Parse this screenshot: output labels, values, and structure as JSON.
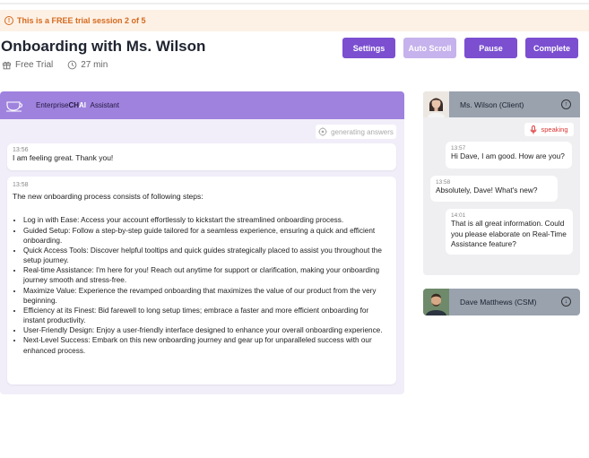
{
  "banner": {
    "text": "This is a FREE trial session 2 of 5"
  },
  "session": {
    "title": "Onboarding with Ms. Wilson",
    "type": "Free Trial",
    "duration": "27 min"
  },
  "toolbar": {
    "settings_label": "Settings",
    "auto_scroll_label": "Auto Scroll",
    "pause_label": "Pause",
    "complete_label": "Complete"
  },
  "assistant": {
    "brand_prefix": "Enterprise",
    "brand_ch": "CH",
    "brand_ai": "AI",
    "brand_suffix": "Assistant",
    "status": "generating answers",
    "messages": [
      {
        "time": "13:56",
        "text": "I am feeling great. Thank you!"
      },
      {
        "time": "13:58",
        "intro": "The new onboarding process consists of following steps:",
        "steps": [
          "Log in with Ease: Access your account effortlessly to kickstart the streamlined onboarding process.",
          "Guided Setup: Follow a step-by-step guide tailored for a seamless experience, ensuring a quick and efficient onboarding.",
          "Quick Access Tools: Discover helpful tooltips and quick guides strategically placed to assist you throughout the setup journey.",
          "Real-time Assistance: I'm here for you! Reach out anytime for support or clarification, making your onboarding journey smooth and stress-free.",
          "Maximize Value: Experience the revamped onboarding that maximizes the value of our product from the very beginning.",
          "Efficiency at its Finest: Bid farewell to long setup times; embrace a faster and more efficient onboarding for instant productivity.",
          "User-Friendly Design: Enjoy a user-friendly interface designed to enhance your overall onboarding experience.",
          "Next-Level Success: Embark on this new onboarding journey and gear up for unparalleled success with our enhanced process."
        ]
      }
    ]
  },
  "client": {
    "name": "Ms. Wilson (Client)",
    "status": "speaking",
    "messages": [
      {
        "time": "13:57",
        "text": "Hi Dave, I am good. How are you?"
      },
      {
        "time": "13:58",
        "text": "Absolutely, Dave! What's new?"
      },
      {
        "time": "14:01",
        "text": "That is all great information. Could you please elaborate on Real-Time Assistance feature?"
      }
    ]
  },
  "csm": {
    "name": "Dave Matthews (CSM)"
  },
  "colors": {
    "accent": "#7b4fd0",
    "accent_disabled": "#c6b2ec",
    "banner_text": "#d56a1e",
    "speaking": "#d33333"
  }
}
